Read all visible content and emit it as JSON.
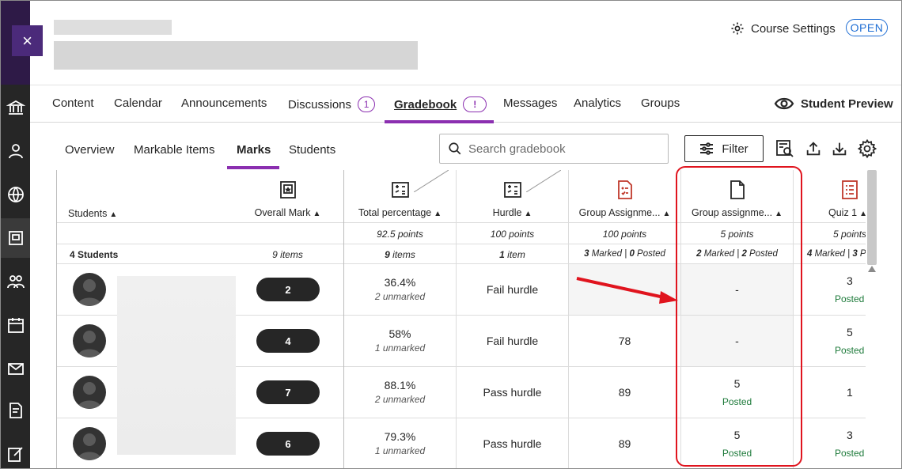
{
  "header": {
    "close_label": "×",
    "course_settings_label": "Course Settings",
    "status_badge": "OPEN"
  },
  "nav": {
    "tabs": [
      {
        "label": "Content"
      },
      {
        "label": "Calendar"
      },
      {
        "label": "Announcements"
      },
      {
        "label": "Discussions",
        "badge": "1"
      },
      {
        "label": "Gradebook",
        "badge": "!",
        "active": true
      },
      {
        "label": "Messages"
      },
      {
        "label": "Analytics"
      },
      {
        "label": "Groups"
      }
    ],
    "student_preview_label": "Student Preview"
  },
  "subnav": {
    "tabs": [
      {
        "label": "Overview"
      },
      {
        "label": "Markable Items"
      },
      {
        "label": "Marks",
        "active": true
      },
      {
        "label": "Students"
      }
    ],
    "search_placeholder": "Search gradebook",
    "filter_label": "Filter"
  },
  "grid": {
    "columns": [
      {
        "label": "Students",
        "points": "",
        "items": "4 Students"
      },
      {
        "label": "Overall Mark",
        "points": "",
        "items": "9 items"
      },
      {
        "label": "Total percentage",
        "points": "92.5 points",
        "items_bold": "9",
        "items_rest": " items"
      },
      {
        "label": "Hurdle",
        "points": "100 points",
        "items_bold": "1",
        "items_rest": " item"
      },
      {
        "label": "Group Assignme...",
        "points": "100 points",
        "items_bold": "3",
        "items_mid": " Marked | ",
        "items_bold2": "0",
        "items_rest": " Posted"
      },
      {
        "label": "Group assignme...",
        "points": "5 points",
        "items_bold": "2",
        "items_mid": " Marked | ",
        "items_bold2": "2",
        "items_rest": " Posted"
      },
      {
        "label": "Quiz 1",
        "points": "5 points",
        "items_bold": "4",
        "items_mid": " Marked | ",
        "items_bold2": "3",
        "items_rest": " P"
      }
    ],
    "rows": [
      {
        "overall": "2",
        "pct": "36.4%",
        "pct_sub": "2 unmarked",
        "hurdle": "Fail hurdle",
        "ga": "",
        "gb": "-",
        "gb_posted": "",
        "quiz": "3",
        "quiz_posted": "Posted"
      },
      {
        "overall": "4",
        "pct": "58%",
        "pct_sub": "1 unmarked",
        "hurdle": "Fail hurdle",
        "ga": "78",
        "gb": "-",
        "gb_posted": "",
        "quiz": "5",
        "quiz_posted": "Posted"
      },
      {
        "overall": "7",
        "pct": "88.1%",
        "pct_sub": "2 unmarked",
        "hurdle": "Pass hurdle",
        "ga": "89",
        "gb": "5",
        "gb_posted": "Posted",
        "quiz": "1",
        "quiz_posted": ""
      },
      {
        "overall": "6",
        "pct": "79.3%",
        "pct_sub": "1 unmarked",
        "hurdle": "Pass hurdle",
        "ga": "89",
        "gb": "5",
        "gb_posted": "Posted",
        "quiz": "3",
        "quiz_posted": "Posted"
      }
    ]
  },
  "colors": {
    "accent": "#8b2fb0",
    "link_blue": "#1f6ed4",
    "posted_green": "#1d7a3a",
    "highlight_red": "#e0141e",
    "rail_dark": "#262626"
  },
  "icons": [
    "close-icon",
    "gear-icon",
    "eye-icon",
    "search-icon",
    "filter-icon",
    "report-icon",
    "upload-icon",
    "download-icon",
    "settings-icon",
    "overall-mark-icon",
    "calculation-icon",
    "assignment-icon",
    "document-icon",
    "quiz-icon"
  ]
}
